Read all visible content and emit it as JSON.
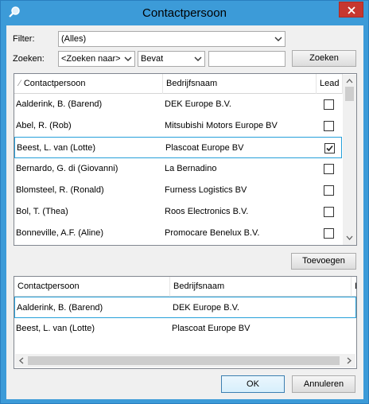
{
  "window": {
    "title": "Contactpersoon",
    "close_icon": "close-icon",
    "app_icon": "search-icon"
  },
  "filter": {
    "label": "Filter:",
    "value": "(Alles)"
  },
  "search": {
    "label": "Zoeken:",
    "field_value": "<Zoeken naar>",
    "operator_value": "Bevat",
    "text_value": "",
    "button_label": "Zoeken"
  },
  "top_grid": {
    "columns": [
      "Contactpersoon",
      "Bedrijfsnaam",
      "Lead"
    ],
    "sort_indicator": "⁄",
    "rows": [
      {
        "contact": "Aalderink, B.  (Barend)",
        "company": "DEK Europe B.V.",
        "lead": false
      },
      {
        "contact": "Abel, R.  (Rob)",
        "company": "Mitsubishi Motors Europe BV",
        "lead": false
      },
      {
        "contact": "Beest, L. van (Lotte)",
        "company": "Plascoat Europe BV",
        "lead": true
      },
      {
        "contact": "Bernardo, G. di (Giovanni)",
        "company": "La Bernadino",
        "lead": false
      },
      {
        "contact": "Blomsteel, R.  (Ronald)",
        "company": "Furness Logistics BV",
        "lead": false
      },
      {
        "contact": "Bol, T.  (Thea)",
        "company": "Roos Electronics B.V.",
        "lead": false
      },
      {
        "contact": "Bonneville, A.F.  (Aline)",
        "company": "Promocare Benelux B.V.",
        "lead": false
      }
    ]
  },
  "add_button": {
    "label": "Toevoegen"
  },
  "bottom_grid": {
    "columns": [
      "Contactpersoon",
      "Bedrijfsnaam",
      "L"
    ],
    "rows": [
      {
        "contact": "Aalderink, B.  (Barend)",
        "company": "DEK Europe B.V."
      },
      {
        "contact": "Beest, L. van (Lotte)",
        "company": "Plascoat Europe BV"
      }
    ]
  },
  "footer": {
    "ok_label": "OK",
    "cancel_label": "Annuleren"
  }
}
